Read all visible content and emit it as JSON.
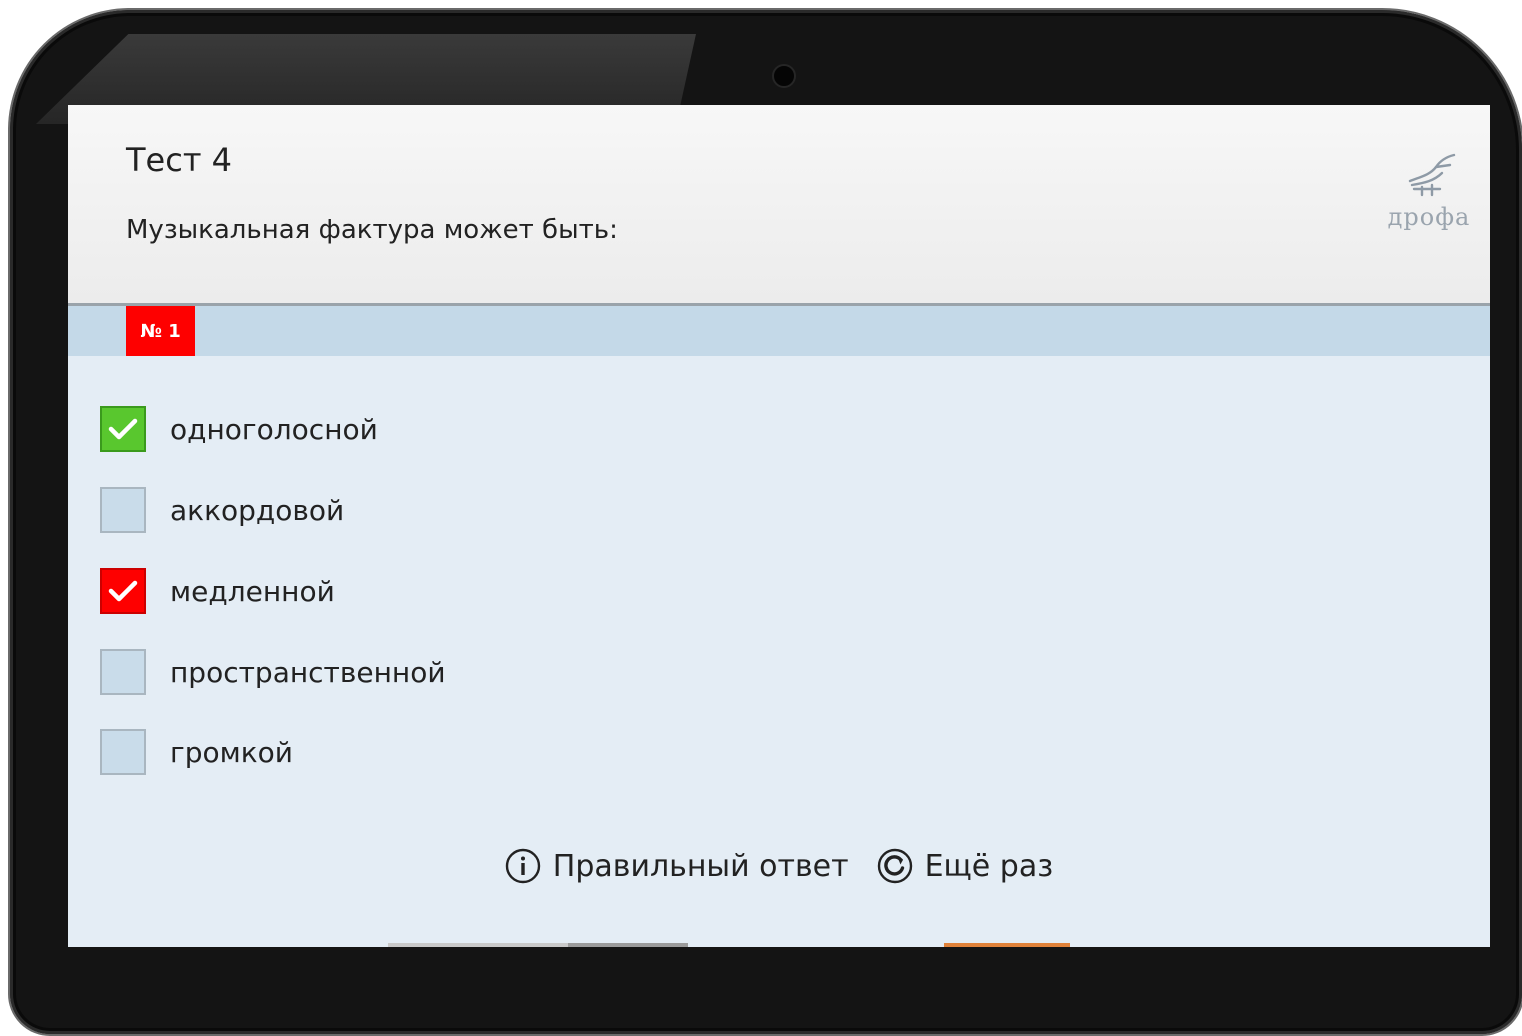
{
  "header": {
    "test_title": "Тест 4",
    "question": "Музыкальная фактура может быть:",
    "logo_text": "дрофа"
  },
  "question_badge": "№ 1",
  "answers": [
    {
      "label": "одноголосной",
      "state": "checked-correct",
      "color": "#59c72e"
    },
    {
      "label": "аккордовой",
      "state": "unchecked"
    },
    {
      "label": "медленной",
      "state": "checked-wrong",
      "color": "#fe0000"
    },
    {
      "label": "пространственной",
      "state": "unchecked"
    },
    {
      "label": "громкой",
      "state": "unchecked"
    }
  ],
  "footer": {
    "correct_answer_label": "Правильный ответ",
    "retry_label": "Ещё раз",
    "correct_answer_icon": "info-circle-icon",
    "retry_icon": "refresh-circle-icon"
  },
  "colors": {
    "badge": "#fe0000",
    "band": "#c4d9e8",
    "background": "#e4edf5"
  }
}
